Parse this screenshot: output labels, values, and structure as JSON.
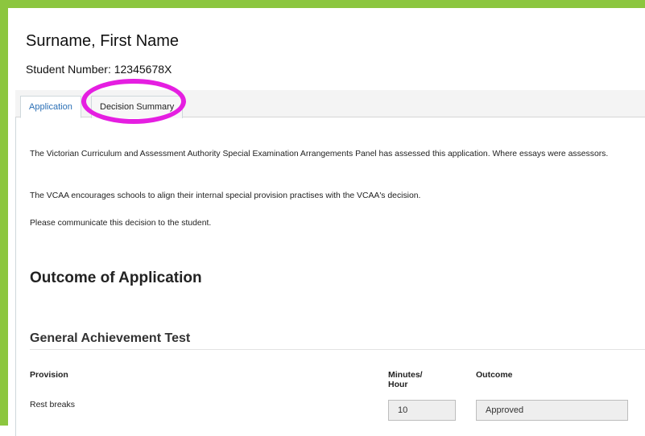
{
  "header": {
    "name": "Surname, First Name",
    "student_number_label": "Student Number: ",
    "student_number_value": "12345678X"
  },
  "tabs": [
    {
      "label": "Application",
      "active": true
    },
    {
      "label": "Decision Summary",
      "active": false
    }
  ],
  "highlight": {
    "color": "#e51ee1"
  },
  "body": {
    "para1": "The Victorian Curriculum and Assessment Authority Special Examination Arrangements Panel has assessed this application. Where essays were assessors.",
    "para2": "The VCAA encourages schools to align their internal special provision practises with the VCAA's decision.",
    "para3": "Please communicate this decision to the student."
  },
  "outcome": {
    "title": "Outcome of Application",
    "section": "General Achievement Test",
    "columns": {
      "provision": "Provision",
      "minutes_line1": "Minutes/",
      "minutes_line2": "Hour",
      "outcome": "Outcome"
    },
    "rows": [
      {
        "provision": "Rest breaks",
        "minutes": "10",
        "outcome": "Approved"
      }
    ]
  },
  "colors": {
    "frame_border": "#8cc63f",
    "active_tab_text": "#2a6fb5"
  }
}
